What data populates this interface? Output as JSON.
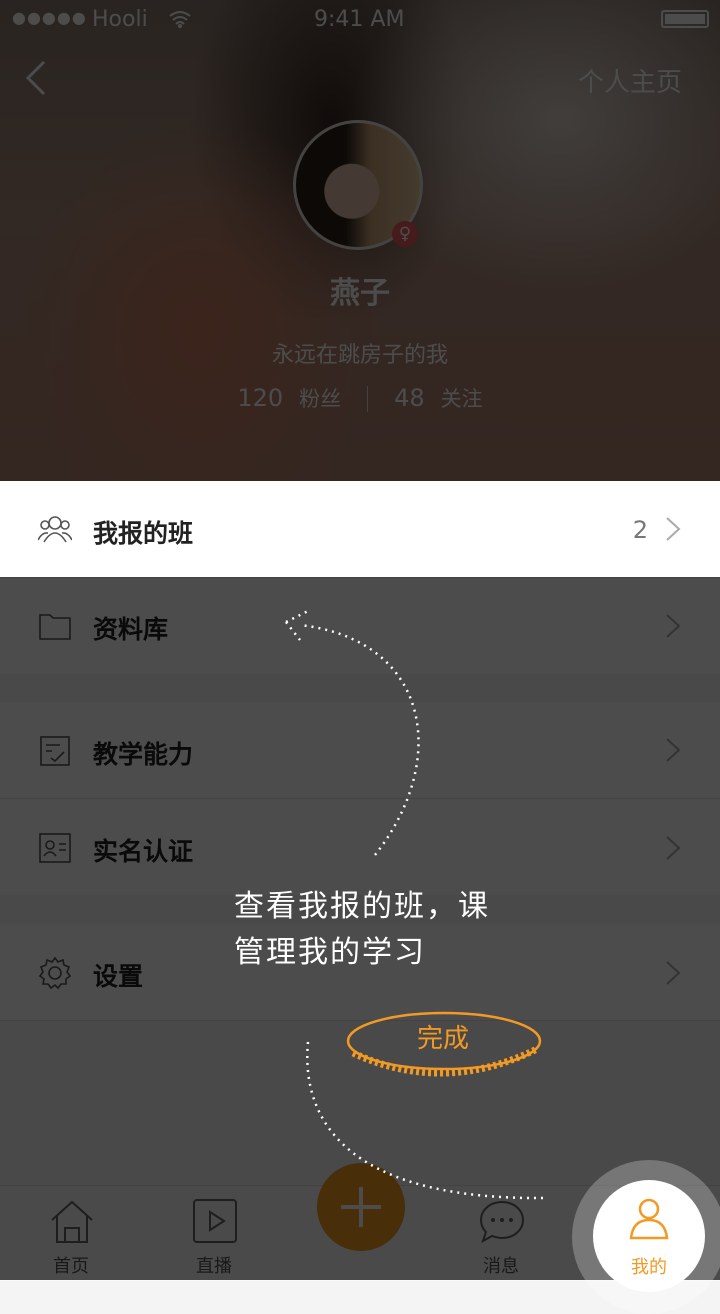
{
  "status_bar": {
    "carrier": "Hooli",
    "time": "9:41 AM"
  },
  "header": {
    "profile_link": "个人主页",
    "name": "燕子",
    "bio": "永远在跳房子的我",
    "followers_count": "120",
    "followers_label": "粉丝",
    "following_count": "48",
    "following_label": "关注"
  },
  "menu": [
    {
      "label": "我报的班",
      "badge": "2"
    },
    {
      "label": "资料库"
    },
    {
      "label": "教学能力"
    },
    {
      "label": "实名认证"
    },
    {
      "label": "设置"
    }
  ],
  "tabbar": {
    "home": "首页",
    "live": "直播",
    "messages": "消息",
    "mine": "我的"
  },
  "guide": {
    "hint_line1": "查看我报的班，课",
    "hint_line2": "管理我的学习",
    "done_label": "完成"
  },
  "colors": {
    "accent": "#f39a24",
    "gender": "#e85a5a",
    "overlay": "rgba(0,0,0,0.7)"
  }
}
